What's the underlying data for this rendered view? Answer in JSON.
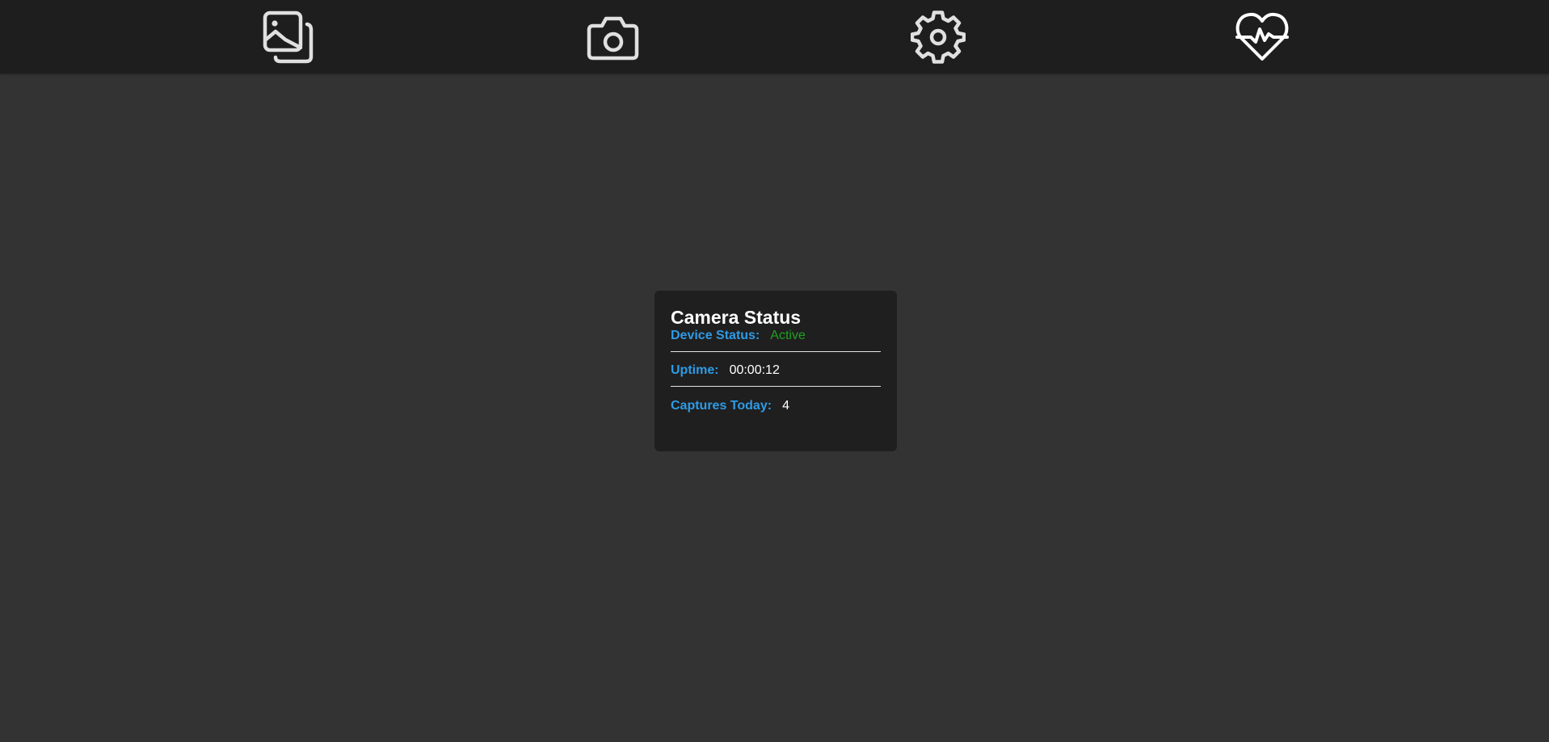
{
  "nav": {
    "items": [
      {
        "id": "gallery",
        "icon": "gallery-icon"
      },
      {
        "id": "camera",
        "icon": "camera-icon"
      },
      {
        "id": "settings",
        "icon": "gear-icon"
      },
      {
        "id": "health",
        "icon": "heart-pulse-icon"
      }
    ],
    "icon_color": "#e0e0e0",
    "background": "#1e1e1e"
  },
  "status_card": {
    "title": "Camera Status",
    "device_status": {
      "label": "Device Status:",
      "value": "Active"
    },
    "uptime": {
      "label": "Uptime:",
      "value": "00:00:12"
    },
    "captures": {
      "label": "Captures Today:",
      "value": "4"
    }
  },
  "colors": {
    "page_background": "#333333",
    "card_background": "#1f1f1f",
    "label": "#2e9be6",
    "status_ok": "#22a022"
  }
}
